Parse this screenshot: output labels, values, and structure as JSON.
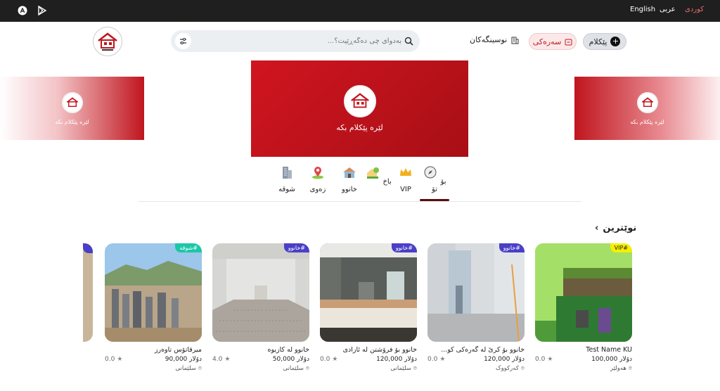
{
  "topbar": {
    "languages": [
      "کوردی",
      "عربی",
      "English"
    ],
    "active_language": "کوردی",
    "icons": [
      "app-store-icon",
      "play-store-icon"
    ]
  },
  "header": {
    "search_placeholder": "بەدوای چی دەگەڕێیت؟...",
    "offices_label": "نوسینگەکان",
    "sar_label": "سەرەکی",
    "ad_label": "پێکلام"
  },
  "banners": {
    "side_text": "لێرە پێکلام بکە",
    "main_text": "لێرە پێکلام بکە"
  },
  "categories": [
    {
      "label": "بۆ تۆ",
      "icon": "compass-icon"
    },
    {
      "label": "VIP",
      "icon": "crown-icon"
    },
    {
      "label": "باخ",
      "icon": "garden-icon"
    },
    {
      "label": "خانوو",
      "icon": "house-icon"
    },
    {
      "label": "زەوی",
      "icon": "land-pin-icon"
    },
    {
      "label": "شوقە",
      "icon": "apartment-icon"
    }
  ],
  "section": {
    "title": "نوێترین"
  },
  "cards": [
    {
      "tag": "VIP#",
      "tag_color": "#f5ef00",
      "title": "Test Name KU",
      "price": "100,000 دۆلار",
      "rating": "0.0",
      "location": "هەولێر"
    },
    {
      "tag": "خانوو#",
      "tag_color": "#4a3fc7",
      "title": "خانوو بۆ کرێ لە گەرەکی کو...",
      "price": "120,000 دۆلار",
      "rating": "0.0",
      "location": "کەرکووک"
    },
    {
      "tag": "خانوو#",
      "tag_color": "#4a3fc7",
      "title": "خانوو بۆ فرۆشتن لە ئازادی",
      "price": "120,000 دۆلار",
      "rating": "0.0",
      "location": "سلێمانی"
    },
    {
      "tag": "خانوو#",
      "tag_color": "#4a3fc7",
      "title": "خانوو لە کازیوە",
      "price": "50,000 دۆلار",
      "rating": "4.0",
      "location": "سلێمانی"
    },
    {
      "tag": "شوقە#",
      "tag_color": "#1bc7a8",
      "title": "میرقاتۆس تاوەرز",
      "price": "90,000 دۆلار",
      "rating": "0.0",
      "location": "سلێمانی"
    }
  ]
}
